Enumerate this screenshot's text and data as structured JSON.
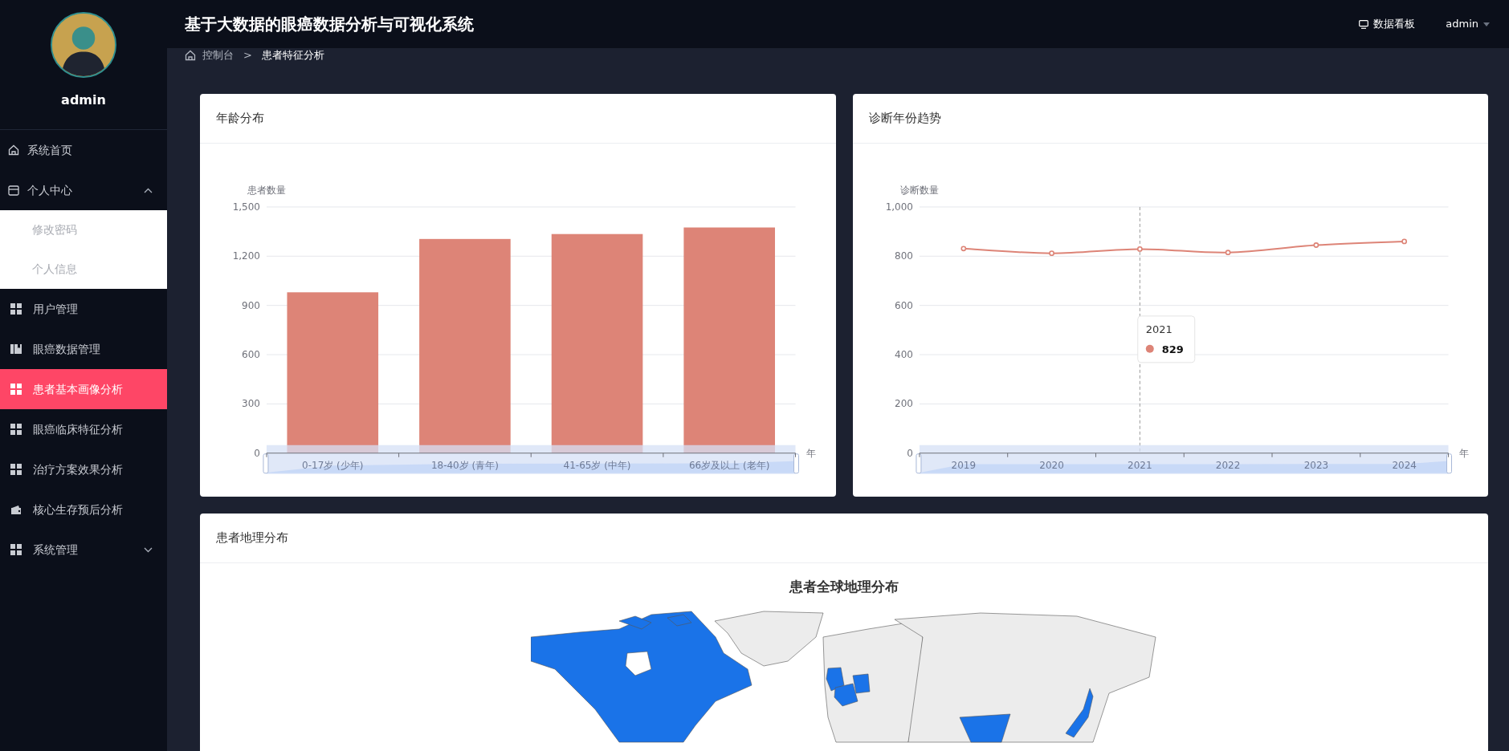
{
  "header": {
    "title": "基于大数据的眼癌数据分析与可视化系统",
    "dashboard_link": "数据看板",
    "user_menu": "admin"
  },
  "sidebar": {
    "user": "admin",
    "items": [
      {
        "label": "系统首页",
        "selected": false
      },
      {
        "label": "个人中心",
        "selected": false,
        "expanded": true,
        "children": [
          {
            "label": "修改密码",
            "selected": false
          },
          {
            "label": "个人信息",
            "selected": false
          }
        ]
      },
      {
        "label": "用户管理",
        "selected": false
      },
      {
        "label": "眼癌数据管理",
        "selected": false
      },
      {
        "label": "患者基本画像分析",
        "selected": true
      },
      {
        "label": "眼癌临床特征分析",
        "selected": false
      },
      {
        "label": "治疗方案效果分析",
        "selected": false
      },
      {
        "label": "核心生存预后分析",
        "selected": false
      },
      {
        "label": "系统管理",
        "selected": false,
        "expanded": false
      }
    ]
  },
  "breadcrumb": {
    "items": [
      "控制台",
      "患者特征分析"
    ],
    "separator": ">"
  },
  "charts": [
    {
      "title": "年龄分布",
      "chart_data": {
        "type": "bar",
        "ylabel": "患者数量",
        "xlabel": "年",
        "categories": [
          "0-17岁 (少年)",
          "18-40岁 (青年)",
          "41-65岁 (中年)",
          "66岁及以上 (老年)"
        ],
        "series": [
          {
            "color": "#dd8477",
            "values": [
              980,
              1305,
              1335,
              1375
            ]
          }
        ],
        "grid": true,
        "ylim": [
          0,
          1500
        ],
        "yticks": [
          {
            "value": 0,
            "label": "0"
          },
          {
            "value": 300,
            "label": "300"
          },
          {
            "value": 600,
            "label": "600"
          },
          {
            "value": 900,
            "label": "900"
          },
          {
            "value": 1200,
            "label": "1,200"
          },
          {
            "value": 1500,
            "label": "1,500"
          }
        ]
      }
    },
    {
      "title": "诊断年份趋势",
      "chart_data": {
        "type": "line",
        "ylabel": "诊断数量",
        "xlabel": "年",
        "categories": [
          "2019",
          "2020",
          "2021",
          "2022",
          "2023",
          "2024"
        ],
        "series": [
          {
            "color": "#dd8477",
            "values": [
              831,
              812,
              829,
              815,
              845,
              860
            ],
            "marker": true
          }
        ],
        "grid": true,
        "ylim": [
          0,
          1000
        ],
        "yticks": [
          {
            "value": 0,
            "label": "0"
          },
          {
            "value": 200,
            "label": "200"
          },
          {
            "value": 400,
            "label": "400"
          },
          {
            "value": 600,
            "label": "600"
          },
          {
            "value": 800,
            "label": "800"
          },
          {
            "value": 1000,
            "label": "1,000"
          }
        ],
        "ref_lines": [
          {
            "axis": "x",
            "value": "2021"
          }
        ]
      },
      "tooltip": {
        "title": "2021",
        "value": "829"
      }
    }
  ],
  "map_panel": {
    "title": "患者地理分布",
    "map_title": "患者全球地理分布"
  }
}
